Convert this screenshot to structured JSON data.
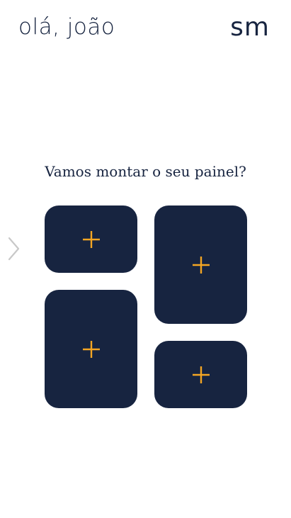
{
  "header": {
    "greeting": "olá, joão",
    "user_initials": "sm"
  },
  "main": {
    "prompt": "Vamos montar o seu painel?",
    "nav_arrow_icon": "chevron-right-icon",
    "tiles": [
      {
        "icon": "plus-icon"
      },
      {
        "icon": "plus-icon"
      },
      {
        "icon": "plus-icon"
      },
      {
        "icon": "plus-icon"
      }
    ]
  },
  "colors": {
    "navy": "#172440",
    "accent": "#F5A623",
    "muted": "#C8C8C8"
  }
}
